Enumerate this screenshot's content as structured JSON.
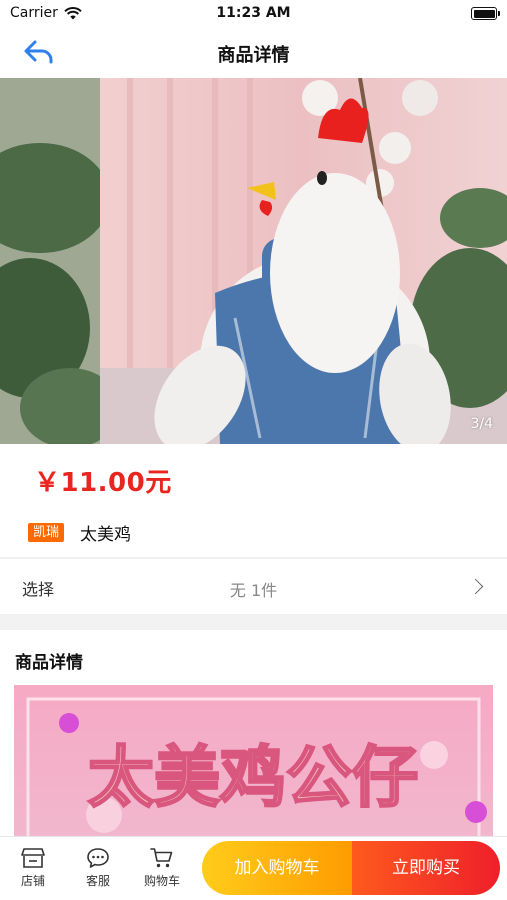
{
  "status_bar": {
    "carrier": "Carrier",
    "time": "11:23 AM"
  },
  "nav": {
    "title": "商品详情"
  },
  "gallery": {
    "counter": "3/4"
  },
  "product": {
    "price": "￥11.00元",
    "brand": "凯瑞",
    "name": "太美鸡"
  },
  "option": {
    "label": "选择",
    "value": "无 1件"
  },
  "detail": {
    "heading": "商品详情",
    "banner_text": "太美鸡公仔"
  },
  "bottom_bar": {
    "tabs": [
      {
        "label": "店铺",
        "icon": "store-icon"
      },
      {
        "label": "客服",
        "icon": "chat-icon"
      },
      {
        "label": "购物车",
        "icon": "cart-icon"
      }
    ],
    "add_to_cart": "加入购物车",
    "buy_now": "立即购买"
  },
  "colors": {
    "price_red": "#e8261f",
    "brand_orange": "#ff6a00",
    "back_blue": "#2f80ed",
    "cart_gradient": [
      "#ffcc1a",
      "#ff9c00"
    ],
    "buy_gradient": [
      "#ff5a1e",
      "#ee1f2a"
    ]
  }
}
